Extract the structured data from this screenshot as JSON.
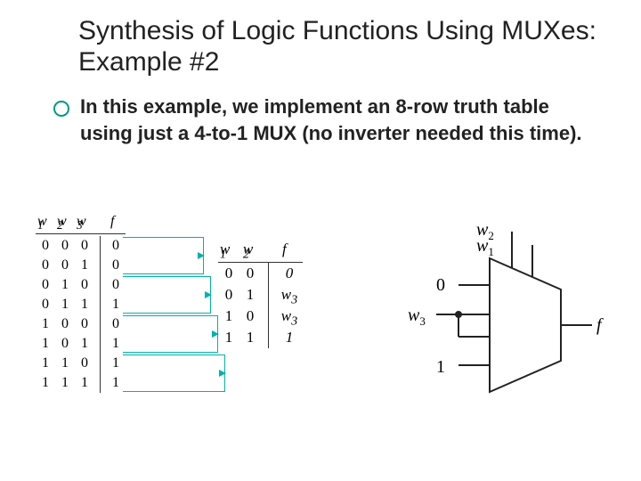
{
  "title": "Synthesis of Logic Functions Using MUXes: Example #2",
  "bullet": "In this example, we implement an 8-row truth table using just a 4-to-1 MUX (no inverter needed this time).",
  "tt8": {
    "headers": {
      "w1": "w",
      "s1": "1",
      "w2": "w",
      "s2": "2",
      "w3": "w",
      "s3": "3",
      "f": "f"
    },
    "w1": [
      "0",
      "0",
      "0",
      "0",
      "1",
      "1",
      "1",
      "1"
    ],
    "w2": [
      "0",
      "0",
      "1",
      "1",
      "0",
      "0",
      "1",
      "1"
    ],
    "w3": [
      "0",
      "1",
      "0",
      "1",
      "0",
      "1",
      "0",
      "1"
    ],
    "f": [
      "0",
      "0",
      "0",
      "1",
      "0",
      "1",
      "1",
      "1"
    ]
  },
  "tt4": {
    "headers": {
      "w1": "w",
      "s1": "1",
      "w2": "w",
      "s2": "2",
      "f": "f"
    },
    "w1": [
      "0",
      "0",
      "1",
      "1"
    ],
    "w2": [
      "0",
      "1",
      "0",
      "1"
    ],
    "f": [
      "0",
      "w",
      "w",
      "1"
    ],
    "fsub": [
      "",
      "3",
      "3",
      ""
    ]
  },
  "mux": {
    "sel_top": "w",
    "sel_top_sub": "2",
    "sel_bot": "w",
    "sel_bot_sub": "1",
    "in0": "0",
    "in1": "w",
    "in1_sub": "3",
    "in3": "1",
    "out": "f"
  },
  "chart_data": {
    "type": "table",
    "truth_table_8": {
      "columns": [
        "w1",
        "w2",
        "w3",
        "f"
      ],
      "rows": [
        [
          0,
          0,
          0,
          0
        ],
        [
          0,
          0,
          1,
          0
        ],
        [
          0,
          1,
          0,
          0
        ],
        [
          0,
          1,
          1,
          1
        ],
        [
          1,
          0,
          0,
          0
        ],
        [
          1,
          0,
          1,
          1
        ],
        [
          1,
          1,
          0,
          1
        ],
        [
          1,
          1,
          1,
          1
        ]
      ]
    },
    "condensed_table": {
      "columns": [
        "w1",
        "w2",
        "f"
      ],
      "rows": [
        [
          0,
          0,
          "0"
        ],
        [
          0,
          1,
          "w3"
        ],
        [
          1,
          0,
          "w3"
        ],
        [
          1,
          1,
          "1"
        ]
      ]
    },
    "mux": {
      "type": "4-to-1",
      "selects": [
        "w1",
        "w2"
      ],
      "inputs": [
        "0",
        "w3",
        "w3",
        "1"
      ],
      "output": "f"
    }
  }
}
